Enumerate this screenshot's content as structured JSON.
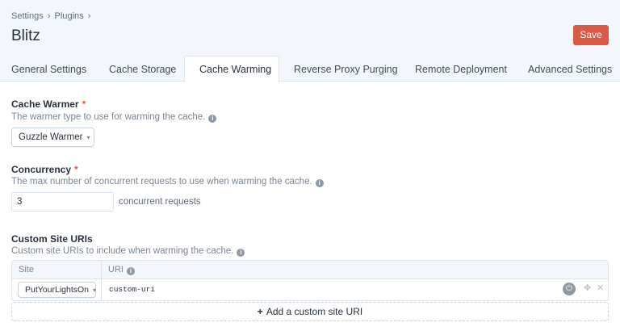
{
  "header": {
    "breadcrumb": [
      "Settings",
      "Plugins"
    ],
    "breadcrumb_sep": "›",
    "title": "Blitz",
    "save_label": "Save"
  },
  "tabs": [
    {
      "label": "General Settings",
      "active": false
    },
    {
      "label": "Cache Storage",
      "active": false
    },
    {
      "label": "Cache Warming",
      "active": true
    },
    {
      "label": "Reverse Proxy Purging",
      "active": false
    },
    {
      "label": "Remote Deployment",
      "active": false
    },
    {
      "label": "Advanced Settings",
      "active": false
    }
  ],
  "cache_warmer": {
    "label": "Cache Warmer",
    "required_mark": "*",
    "description": "The warmer type to use for warming the cache.",
    "selected": "Guzzle Warmer"
  },
  "concurrency": {
    "label": "Concurrency",
    "required_mark": "*",
    "description": "The max number of concurrent requests to use when warming the cache.",
    "value": "3",
    "suffix": "concurrent requests"
  },
  "custom_uris": {
    "label": "Custom Site URIs",
    "description": "Custom site URIs to include when warming the cache.",
    "columns": [
      "Site",
      "URI"
    ],
    "rows": [
      {
        "site": "PutYourLightsOn",
        "uri": "custom-uri"
      }
    ],
    "add_label": "Add a custom site URI"
  },
  "icons": {
    "info": "info-icon",
    "chevron": "chevron-down-icon",
    "power": "power-icon",
    "move": "move-icon",
    "delete": "close-icon",
    "plus": "plus-icon"
  },
  "colors": {
    "accent": "#da5a47",
    "header_bg": "#f3f7fc",
    "border": "#dde3ea"
  }
}
